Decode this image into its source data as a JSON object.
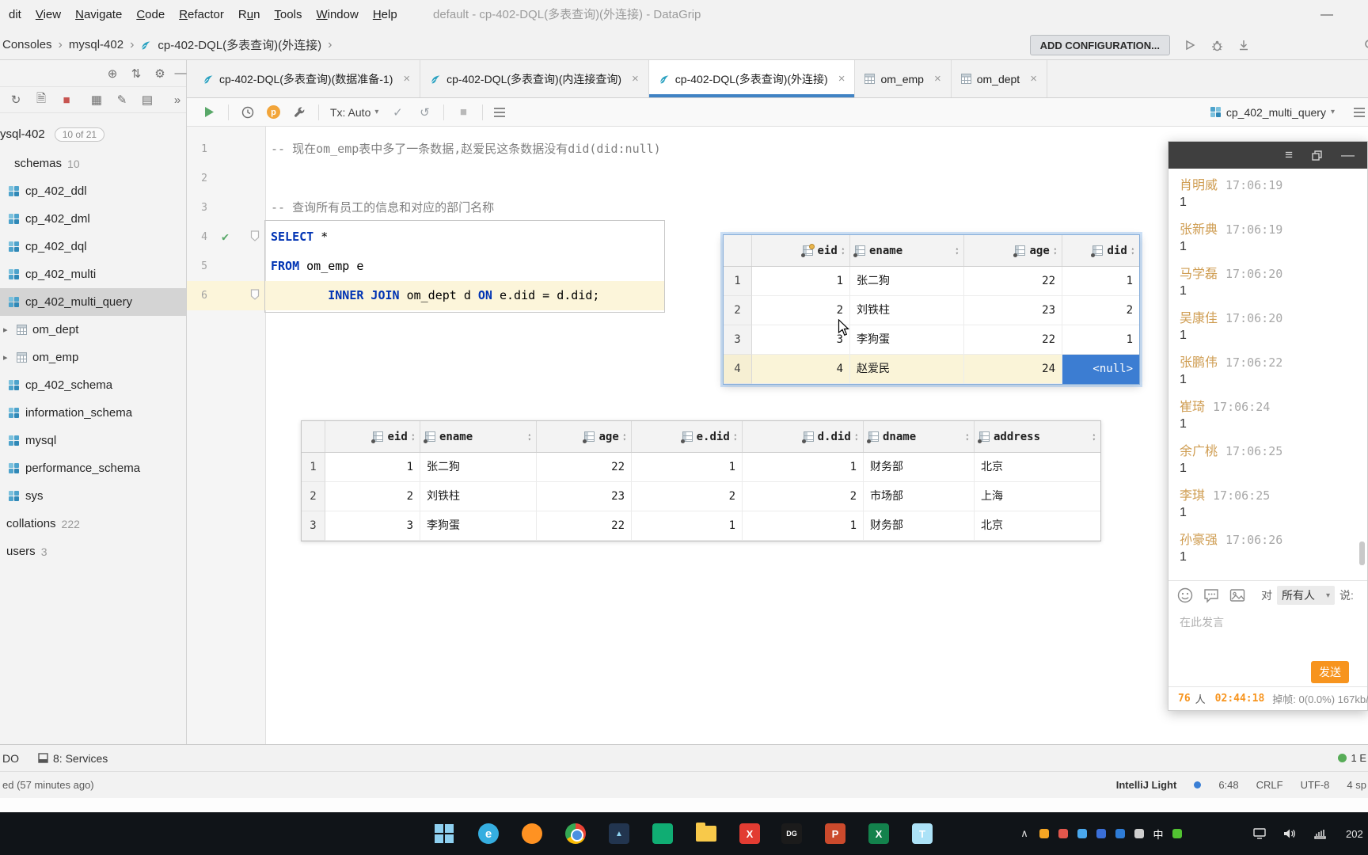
{
  "window": {
    "title": "default - cp-402-DQL(多表查询)(外连接) - DataGrip"
  },
  "menu": {
    "items": [
      {
        "label": "dit",
        "mn": -1
      },
      {
        "label": "View",
        "mn": 0
      },
      {
        "label": "Navigate",
        "mn": 0
      },
      {
        "label": "Code",
        "mn": 0
      },
      {
        "label": "Refactor",
        "mn": 0
      },
      {
        "label": "Run",
        "mn": 1
      },
      {
        "label": "Tools",
        "mn": 0
      },
      {
        "label": "Window",
        "mn": 0
      },
      {
        "label": "Help",
        "mn": 0
      }
    ]
  },
  "navbar": {
    "breadcrumbs": [
      "Consoles",
      "mysql-402",
      "cp-402-DQL(多表查询)(外连接)"
    ],
    "add_configuration": "ADD CONFIGURATION..."
  },
  "tabs": [
    {
      "label": "cp-402-DQL(多表查询)(数据准备-1)",
      "icon": "console",
      "active": false
    },
    {
      "label": "cp-402-DQL(多表查询)(内连接查询)",
      "icon": "console",
      "active": false
    },
    {
      "label": "cp-402-DQL(多表查询)(外连接)",
      "icon": "console",
      "active": true
    },
    {
      "label": "om_emp",
      "icon": "table",
      "active": false
    },
    {
      "label": "om_dept",
      "icon": "table",
      "active": false
    }
  ],
  "toolbar": {
    "tx": "Tx: Auto",
    "session": "cp_402_multi_query"
  },
  "sidebar": {
    "root": {
      "label": "ysql-402",
      "badge": "10 of 21"
    },
    "items": [
      {
        "label": "schemas",
        "count": "10",
        "type": "plain"
      },
      {
        "label": "cp_402_ddl",
        "type": "schema"
      },
      {
        "label": "cp_402_dml",
        "type": "schema"
      },
      {
        "label": "cp_402_dql",
        "type": "schema"
      },
      {
        "label": "cp_402_multi",
        "type": "schema"
      },
      {
        "label": "cp_402_multi_query",
        "type": "schema",
        "selected": true
      },
      {
        "label": "om_dept",
        "type": "table"
      },
      {
        "label": "om_emp",
        "type": "table"
      },
      {
        "label": "cp_402_schema",
        "type": "schema"
      },
      {
        "label": "information_schema",
        "type": "schema"
      },
      {
        "label": "mysql",
        "type": "schema"
      },
      {
        "label": "performance_schema",
        "type": "schema"
      },
      {
        "label": "sys",
        "type": "schema"
      },
      {
        "label": "collations",
        "count": "222",
        "type": "plain2"
      },
      {
        "label": "users",
        "count": "3",
        "type": "plain2"
      }
    ]
  },
  "editor": {
    "lines": [
      {
        "num": "1",
        "parts": [
          {
            "t": "-- 现在om_emp表中多了一条数据,赵爱民这条数据没有did(did:null)",
            "c": "cm"
          }
        ]
      },
      {
        "num": "2",
        "parts": []
      },
      {
        "num": "3",
        "parts": [
          {
            "t": "-- 查询所有员工的信息和对应的部门名称",
            "c": "cm"
          }
        ]
      },
      {
        "num": "4",
        "parts": [
          {
            "t": "SELECT",
            "c": "kw"
          },
          {
            "t": " *",
            "c": "pl"
          }
        ],
        "check": true,
        "pin": true
      },
      {
        "num": "5",
        "parts": [
          {
            "t": "FROM",
            "c": "kw"
          },
          {
            "t": " om_emp e",
            "c": "pl"
          }
        ]
      },
      {
        "num": "6",
        "parts": [
          {
            "t": "        ",
            "c": "pl"
          },
          {
            "t": "INNER JOIN",
            "c": "kw"
          },
          {
            "t": " om_dept d ",
            "c": "pl"
          },
          {
            "t": "ON",
            "c": "kw"
          },
          {
            "t": " e.did = d.did;",
            "c": "pl"
          }
        ],
        "current": true,
        "pin": true
      }
    ]
  },
  "popup_table": {
    "columns": [
      {
        "name": "eid",
        "key": true,
        "align": "right"
      },
      {
        "name": "ename",
        "align": "left"
      },
      {
        "name": "age",
        "align": "right"
      },
      {
        "name": "did",
        "align": "right"
      }
    ],
    "rows": [
      [
        "1",
        "张二狗",
        "22",
        "1"
      ],
      [
        "2",
        "刘铁柱",
        "23",
        "2"
      ],
      [
        "3",
        "李狗蛋",
        "22",
        "1"
      ],
      [
        "4",
        "赵爱民",
        "24",
        "<null>"
      ]
    ],
    "selected": {
      "row": 3,
      "col": 3
    }
  },
  "grid_table": {
    "columns": [
      {
        "name": "eid",
        "align": "right"
      },
      {
        "name": "ename",
        "align": "left"
      },
      {
        "name": "age",
        "align": "right"
      },
      {
        "name": "e.did",
        "align": "right"
      },
      {
        "name": "d.did",
        "align": "right"
      },
      {
        "name": "dname",
        "align": "left"
      },
      {
        "name": "address",
        "align": "left"
      }
    ],
    "rows": [
      [
        "1",
        "张二狗",
        "22",
        "1",
        "1",
        "财务部",
        "北京"
      ],
      [
        "2",
        "刘铁柱",
        "23",
        "2",
        "2",
        "市场部",
        "上海"
      ],
      [
        "3",
        "李狗蛋",
        "22",
        "1",
        "1",
        "财务部",
        "北京"
      ]
    ]
  },
  "chat": {
    "messages": [
      {
        "name": "肖明威",
        "time": "17:06:19",
        "text": "1"
      },
      {
        "name": "张新典",
        "time": "17:06:19",
        "text": "1"
      },
      {
        "name": "马学磊",
        "time": "17:06:20",
        "text": "1"
      },
      {
        "name": "吴康佳",
        "time": "17:06:20",
        "text": "1"
      },
      {
        "name": "张鹏伟",
        "time": "17:06:22",
        "text": "1"
      },
      {
        "name": "崔琦",
        "time": "17:06:24",
        "text": "1"
      },
      {
        "name": "余广桃",
        "time": "17:06:25",
        "text": "1"
      },
      {
        "name": "李琪",
        "time": "17:06:25",
        "text": "1"
      },
      {
        "name": "孙豪强",
        "time": "17:06:26",
        "text": "1"
      }
    ],
    "to_label": "对",
    "audience": "所有人",
    "say_label": "说:",
    "input_placeholder": "在此发言",
    "send_label": "发送",
    "footer": {
      "count": "76",
      "count_suffix": "人",
      "elapsed": "02:44:18",
      "stats": "掉帧: 0(0.0%) 167kb/s"
    }
  },
  "services_bar": {
    "left_partial": "DO",
    "services_label": "8: Services",
    "event_badge": "1 E"
  },
  "status_bar": {
    "left_partial": "ed (57 minutes ago)",
    "theme": "IntelliJ Light",
    "position": "6:48",
    "line_ending": "CRLF",
    "encoding": "UTF-8",
    "indent": "4 sp"
  },
  "taskbar": {
    "apps": [
      {
        "name": "windows-start-button",
        "shape": "start"
      },
      {
        "name": "edge-icon",
        "shape": "circle",
        "bg": "#35aee0",
        "glyph": "e"
      },
      {
        "name": "firefox-icon",
        "shape": "circle",
        "bg": "#ff9222",
        "glyph": ""
      },
      {
        "name": "chrome-icon",
        "shape": "chrome"
      },
      {
        "name": "app-dark-blue-icon",
        "shape": "square",
        "bg": "#22354f",
        "glyph": "▲",
        "fg": "#8fd4f2"
      },
      {
        "name": "app-green-icon",
        "shape": "square",
        "bg": "#10ad73",
        "glyph": ""
      },
      {
        "name": "file-explorer-icon",
        "shape": "folder"
      },
      {
        "name": "app-red-icon",
        "shape": "square",
        "bg": "#e23c32",
        "glyph": "X"
      },
      {
        "name": "datagrip-icon",
        "shape": "square",
        "bg": "#1b1b1b",
        "glyph": "DG"
      },
      {
        "name": "powerpoint-icon",
        "shape": "square",
        "bg": "#cb4a2c",
        "glyph": "P"
      },
      {
        "name": "excel-icon",
        "shape": "square",
        "bg": "#13824c",
        "glyph": "X"
      },
      {
        "name": "app-light-blue-icon",
        "shape": "square",
        "bg": "#ace2f7",
        "glyph": "T"
      }
    ],
    "tray": [
      {
        "name": "tray-expand-chevron",
        "glyph": "∧",
        "color": "#e0e0e0"
      },
      {
        "name": "tray-app-orange",
        "dot": "#f6a623"
      },
      {
        "name": "tray-app-red",
        "dot": "#e2574c"
      },
      {
        "name": "tray-app-skyblue",
        "dot": "#49a8ee"
      },
      {
        "name": "tray-app-blue",
        "dot": "#3a6fd8"
      },
      {
        "name": "tray-bluetooth",
        "dot": "#2e7cd6"
      },
      {
        "name": "tray-microphone",
        "dot": "#cfcfcf"
      },
      {
        "name": "tray-ime-chinese",
        "glyph": "中",
        "color": "#ffffff"
      },
      {
        "name": "tray-wechat",
        "dot": "#52c332"
      }
    ],
    "tray_time_partial": "202"
  },
  "icons": {
    "target": "⊕",
    "sort_updown": "⇅",
    "gear": "⚙",
    "minimize": "—",
    "refresh": "↻",
    "stop": "■",
    "grid": "▦",
    "more": "»",
    "check_green": "✔",
    "check_gray": "✓",
    "undo": "↺",
    "chevron_down": "▾",
    "close": "×",
    "expand": "▸",
    "sort_asc": "▴",
    "sort_desc": "▾",
    "hamburger": "≡",
    "breadcrumb_sep": "›"
  },
  "colors": {
    "accent_blue": "#4083c4",
    "selection_blue": "#3c7dd2",
    "row_highlight": "#faf4d8",
    "chat_orange": "#f7941e",
    "name_orange": "#cf9d52",
    "keyword": "#0033b3",
    "comment": "#808080",
    "run_green": "#59a869"
  }
}
